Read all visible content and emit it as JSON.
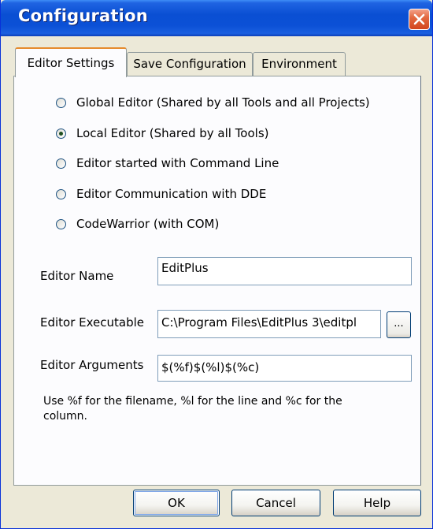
{
  "window": {
    "title": "Configuration"
  },
  "tabs": [
    {
      "label": "Editor Settings"
    },
    {
      "label": "Save Configuration"
    },
    {
      "label": "Environment"
    }
  ],
  "editor_options": [
    {
      "label": "Global Editor (Shared by all Tools and all Projects)",
      "checked": false
    },
    {
      "label": "Local Editor (Shared by all Tools)",
      "checked": true
    },
    {
      "label": "Editor started with Command Line",
      "checked": false
    },
    {
      "label": "Editor Communication with DDE",
      "checked": false
    },
    {
      "label": "CodeWarrior (with COM)",
      "checked": false
    }
  ],
  "fields": {
    "editor_name": {
      "label": "Editor Name",
      "value": "EditPlus"
    },
    "editor_executable": {
      "label": "Editor Executable",
      "value": "C:\\Program Files\\EditPlus 3\\editpl"
    },
    "editor_arguments": {
      "label": "Editor Arguments",
      "value": "$(%f)$(%l)$(%c)"
    }
  },
  "browse_button": {
    "label": "..."
  },
  "help_text": "Use %f for the filename, %l for the line and %c for the column.",
  "buttons": {
    "ok": "OK",
    "cancel": "Cancel",
    "help": "Help"
  }
}
